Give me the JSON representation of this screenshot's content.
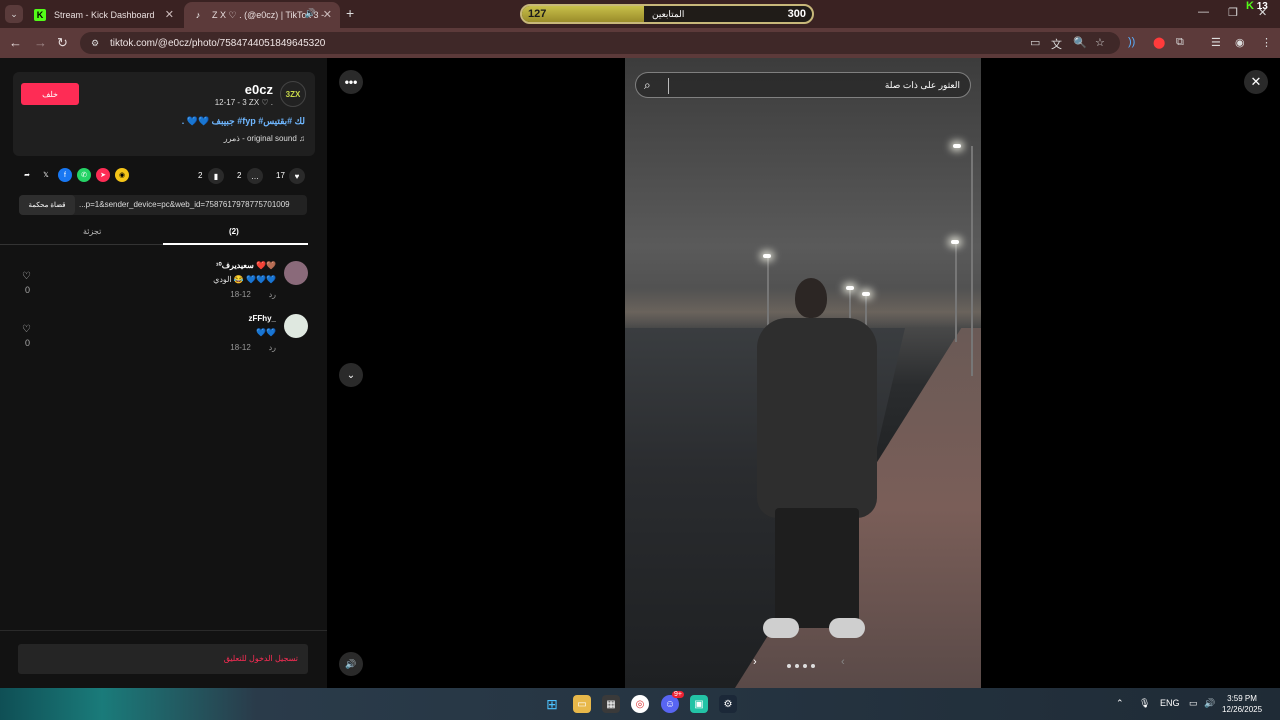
{
  "browser": {
    "tabs": [
      {
        "label": "Stream - Kick Dashboard",
        "favicon": "kick-icon",
        "active": false
      },
      {
        "label": "Z X ♡ . (@e0cz) | TikTok 3 -",
        "favicon": "tiktok-icon",
        "active": true
      }
    ],
    "new_tab": "+",
    "url": "tiktok.com/@e0cz/photo/7584744051849645320",
    "follow_overlay": {
      "current": "127",
      "label": "المتابعين",
      "goal": "300",
      "progress_fraction": 0.42
    },
    "kick_count": "13"
  },
  "post": {
    "follow_button": "خلف",
    "username": "e0cz",
    "subtitle": "12-17 - 3 ZX ♡ .",
    "caption": ". 💙💙 جبيبف #fyp #لك #بقتيس",
    "sound": "ذمرر - original sound",
    "stats": {
      "likes": "17",
      "comments": "2",
      "saves": "2"
    },
    "share_link": "...p=1&sender_device=pc&web_id=7587617978775701009",
    "copy_link": "قضاة محكمة",
    "tabs": [
      {
        "label": "(2)",
        "active": true
      },
      {
        "label": "تجزئة",
        "active": false
      }
    ],
    "comments": [
      {
        "name": "سعيديرف¹⁰ ❤️🤎",
        "text": "الودي 😂 💙💙💙",
        "date": "12-18",
        "reply": "رد",
        "likes": "0",
        "avatar_color": "#8a6a7a"
      },
      {
        "name": "zFFhy_",
        "text": "💙💙",
        "date": "12-18",
        "reply": "رد",
        "likes": "0",
        "avatar_color": "#dfe8e0"
      }
    ],
    "login_prompt": "تسجيل الدخول للتعليق"
  },
  "viewer": {
    "search_placeholder": "العثور على ذات صلة",
    "more": "•••",
    "photo_index_dots": 4
  },
  "taskbar": {
    "lang": "ENG",
    "time": "3:59 PM",
    "date": "12/26/2025",
    "discord_badge": "9+"
  },
  "colors": {
    "accent": "#fe2c55",
    "link_blue": "#6fb7ff",
    "kick_green": "#53fc18"
  }
}
